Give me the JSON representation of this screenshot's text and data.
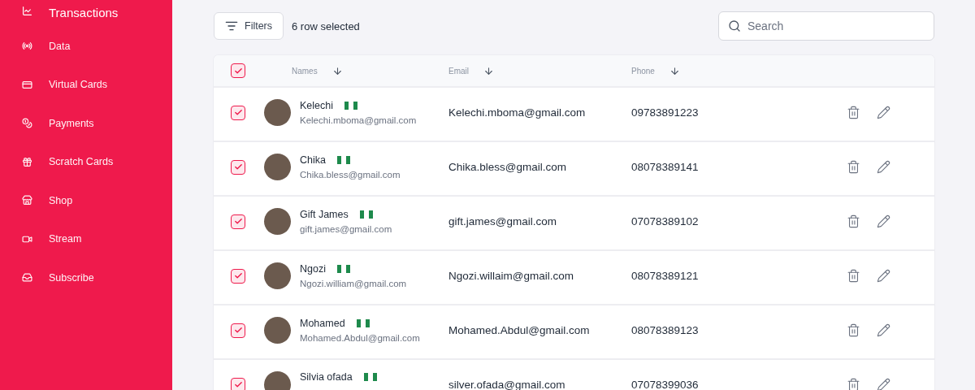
{
  "sidebar": {
    "items": [
      {
        "label": "Transactions",
        "selected": true
      },
      {
        "label": "Data",
        "selected": false
      },
      {
        "label": "Virtual Cards",
        "selected": false
      },
      {
        "label": "Payments",
        "selected": false
      },
      {
        "label": "Scratch Cards",
        "selected": false
      },
      {
        "label": "Shop",
        "selected": false
      },
      {
        "label": "Stream",
        "selected": false
      },
      {
        "label": "Subscribe",
        "selected": false
      }
    ]
  },
  "toolbar": {
    "filters_label": "Filters",
    "selection_text": "6 row selected",
    "search": {
      "placeholder": "Search"
    }
  },
  "table": {
    "all_checked": true,
    "columns": [
      {
        "label": "Names"
      },
      {
        "label": "Email"
      },
      {
        "label": "Phone"
      }
    ],
    "rows": [
      {
        "checked": true,
        "name": "Kelechi",
        "sub_email": "Kelechi.mboma@gmail.com",
        "email": "Kelechi.mboma@gmail.com",
        "phone": "09783891223"
      },
      {
        "checked": true,
        "name": "Chika",
        "sub_email": "Chika.bless@gmail.com",
        "email": "Chika.bless@gmail.com",
        "phone": "08078389141"
      },
      {
        "checked": true,
        "name": "Gift James",
        "sub_email": "gift.james@gmail.com",
        "email": "gift.james@gmail.com",
        "phone": "07078389102"
      },
      {
        "checked": true,
        "name": "Ngozi",
        "sub_email": "Ngozi.william@gmail.com",
        "email": "Ngozi.willaim@gmail.com",
        "phone": "08078389121"
      },
      {
        "checked": true,
        "name": "Mohamed",
        "sub_email": "Mohamed.Abdul@gmail.com",
        "email": "Mohamed.Abdul@gmail.com",
        "phone": "08078389123"
      },
      {
        "checked": true,
        "name": "Silvia ofada",
        "email": "silver.ofada@gmail.com",
        "phone": "07078399036"
      }
    ]
  }
}
